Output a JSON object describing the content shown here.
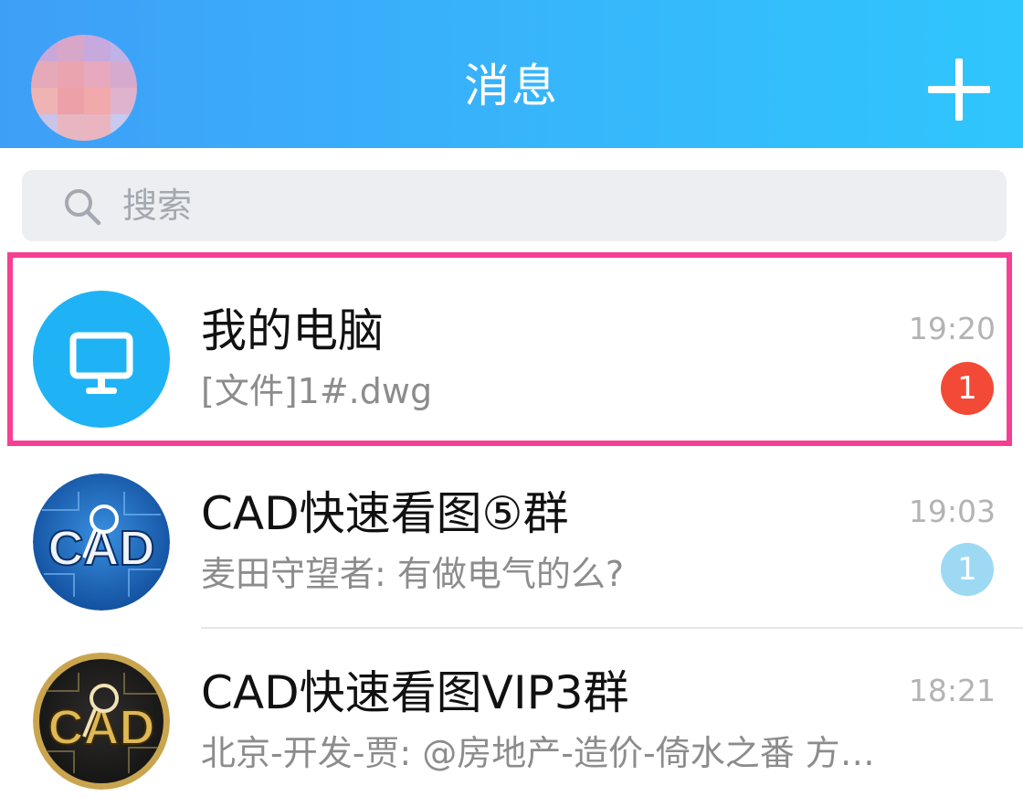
{
  "header": {
    "title": "消息",
    "add_icon": "plus-icon",
    "background_gradient": [
      "#3e9ff7",
      "#2fc6fd"
    ]
  },
  "search": {
    "placeholder": "搜索",
    "icon": "search-icon"
  },
  "chats": [
    {
      "name": "我的电脑",
      "preview": "[文件]1#.dwg",
      "time": "19:20",
      "unread": "1",
      "badge_color": "#f24a37",
      "avatar_icon": "monitor-icon",
      "avatar_color": "#1fb3f5",
      "highlighted": true
    },
    {
      "name": "CAD快速看图⑤群",
      "preview": "麦田守望者: 有做电气的么?",
      "time": "19:03",
      "unread": "1",
      "badge_color": "#9dd9f3",
      "avatar_icon": "cad-blue-logo-icon",
      "highlighted": false
    },
    {
      "name": "CAD快速看图VIP3群",
      "preview": "北京-开发-贾: @房地产-造价-倚水之番 方…",
      "time": "18:21",
      "avatar_icon": "cad-gold-logo-icon",
      "highlighted": false
    }
  ],
  "colors": {
    "highlight_border": "#f63f93",
    "search_background": "#edeef1"
  }
}
